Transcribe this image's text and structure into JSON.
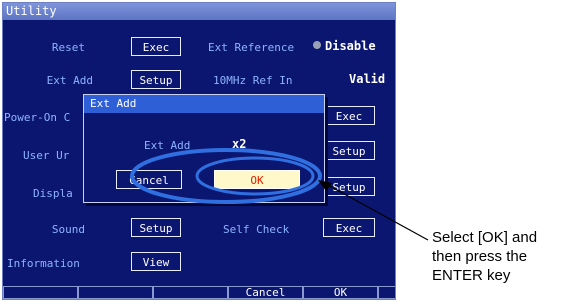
{
  "window": {
    "title": "Utility"
  },
  "rows": {
    "reset_label": "Reset",
    "reset_button": "Exec",
    "ext_add_label": "Ext Add",
    "ext_add_button": "Setup",
    "power_on_label": "Power-On C",
    "user_label": "User Ur",
    "display_label": "Displa",
    "sound_label": "Sound",
    "sound_button": "Setup",
    "information_label": "Information",
    "information_button": "View",
    "ext_reference_label": "Ext Reference",
    "ext_reference_value": "Disable",
    "ref_in_label": "10MHz Ref In",
    "ref_in_value": "Valid",
    "right_button_1": "Exec",
    "right_button_2": "Setup",
    "right_button_3": "Setup",
    "self_check_label": "Self Check",
    "self_check_button": "Exec"
  },
  "dialog": {
    "title": "Ext Add",
    "field_label": "Ext Add",
    "field_value": "x2",
    "cancel_label": "Cancel",
    "ok_label": "OK"
  },
  "softkeys": {
    "cancel": "Cancel",
    "ok": "OK"
  },
  "callout": {
    "line1": "Select [OK] and",
    "line2": "then press the",
    "line3": "ENTER key"
  },
  "colors": {
    "screen_bg": "#0b1670",
    "label_blue": "#8fb3ff",
    "highlight_ring": "#2f6fe0",
    "ok_bg": "#fff8c8",
    "ok_text": "#e02000"
  }
}
